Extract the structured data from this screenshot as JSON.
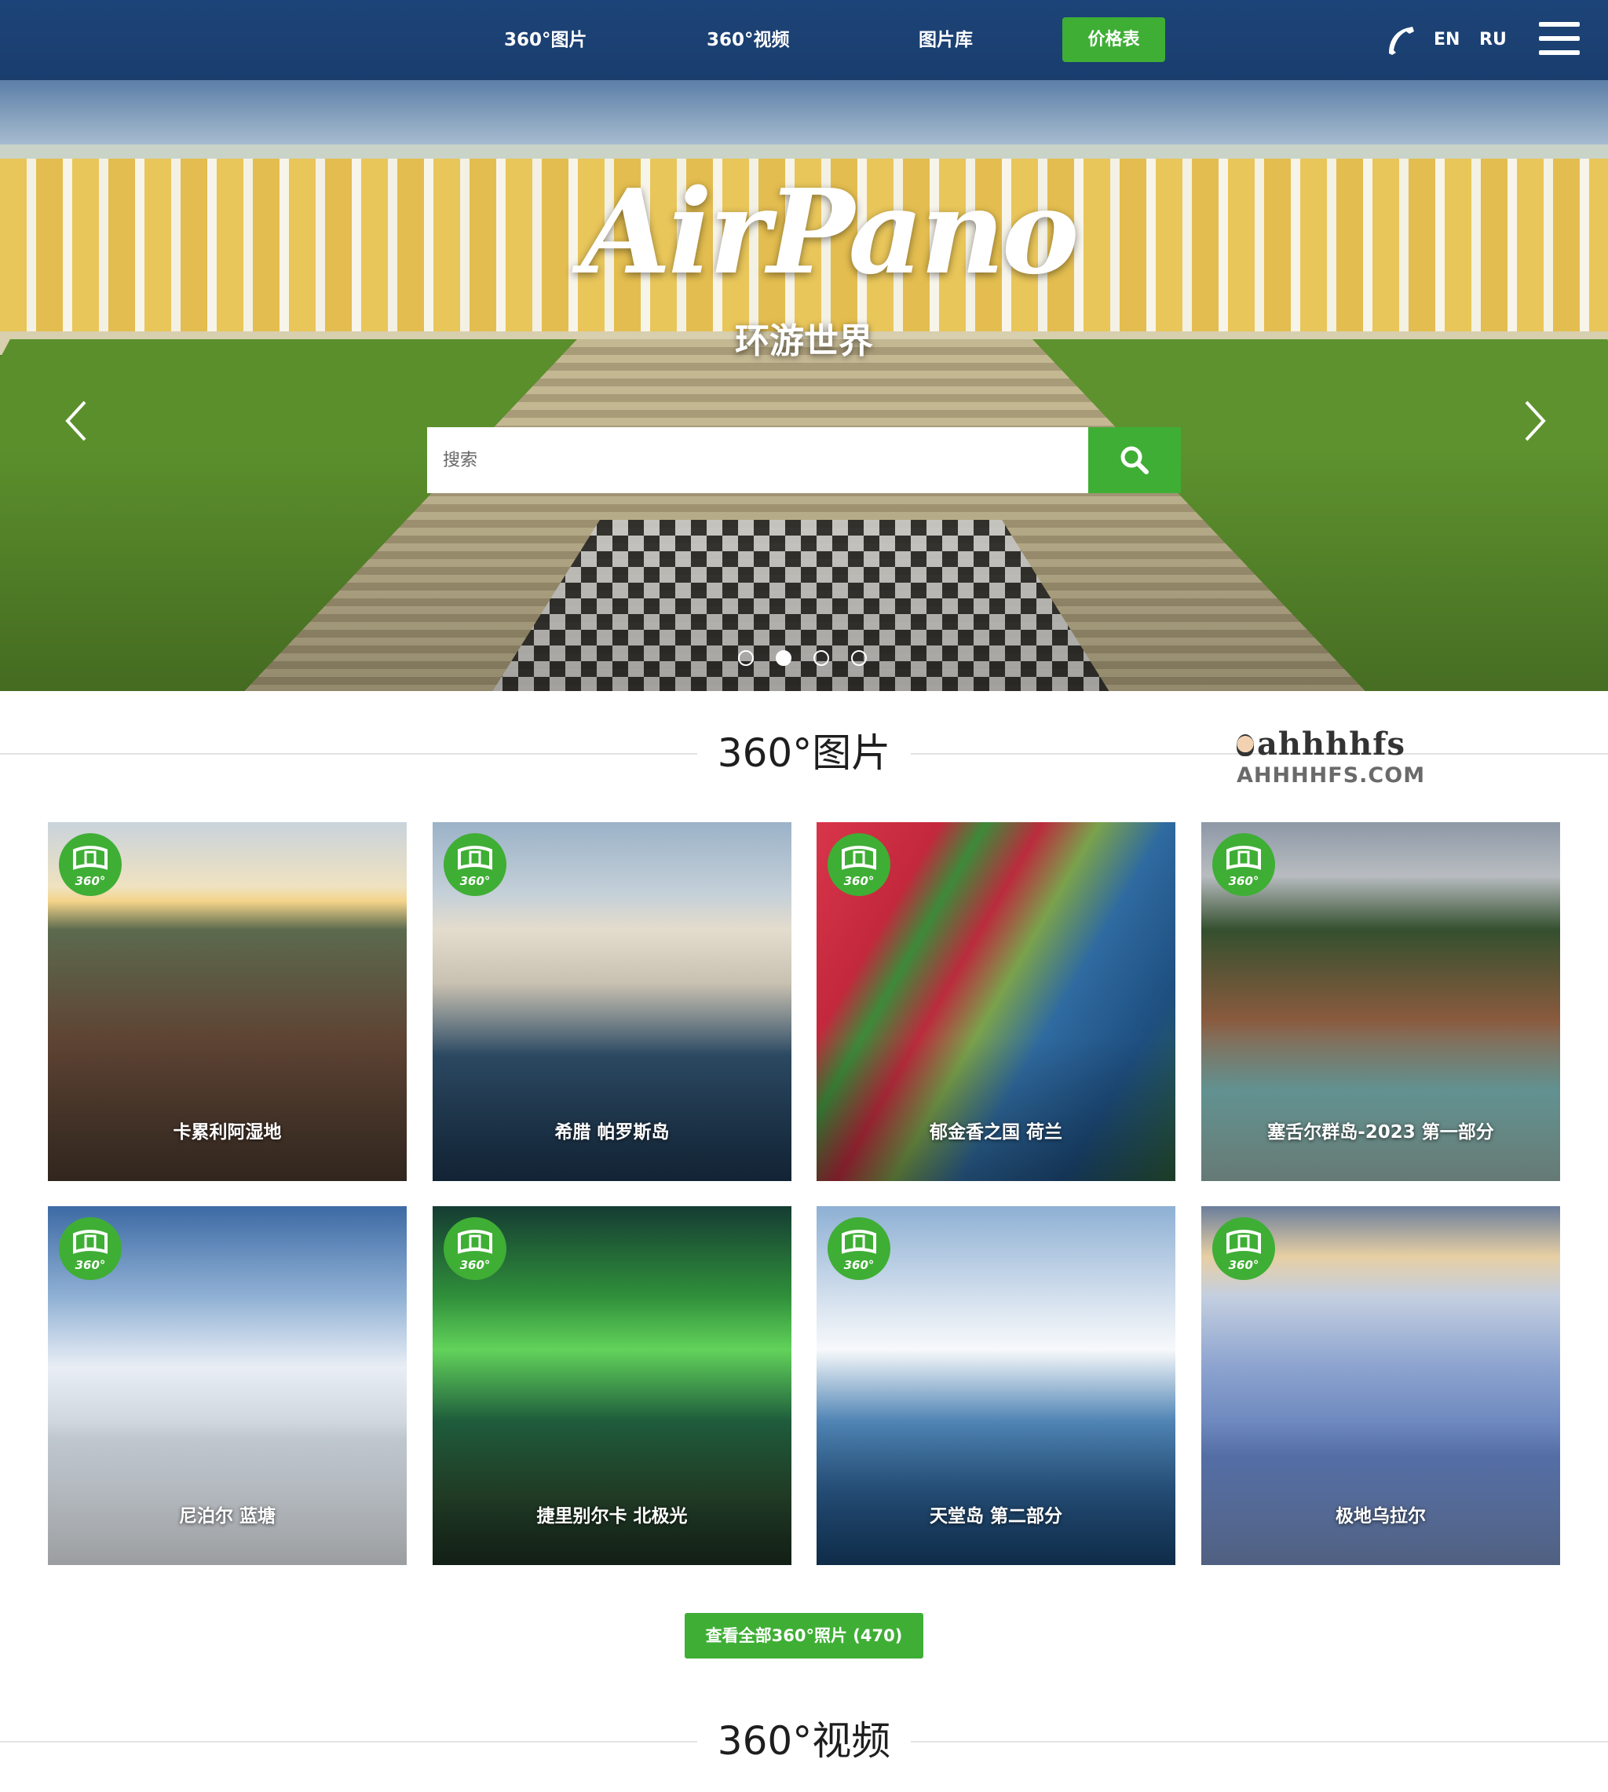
{
  "header": {
    "nav": [
      {
        "label": "360°图片"
      },
      {
        "label": "360°视频"
      },
      {
        "label": "图片库"
      }
    ],
    "price_label": "价格表",
    "languages": [
      "EN",
      "RU"
    ],
    "icons": {
      "phone": "phone-icon",
      "menu": "hamburger-menu-icon"
    },
    "accent_color": "#3fae35",
    "bar_color": "#1d4478"
  },
  "hero": {
    "logo": "AirPano",
    "tagline": "环游世界",
    "search": {
      "placeholder": "搜索",
      "value": ""
    },
    "slider": {
      "slide_count": 4,
      "active_slide": 2
    }
  },
  "photos_section": {
    "title": "360°图片",
    "watermark": {
      "brand": "ahhhhfs",
      "domain": "AHHHHFS.COM"
    },
    "cards": [
      {
        "title": "卡累利阿湿地"
      },
      {
        "title": "希腊 帕罗斯岛"
      },
      {
        "title": "郁金香之国 荷兰"
      },
      {
        "title": "塞舌尔群岛-2023 第一部分"
      },
      {
        "title": "尼泊尔 蓝塘"
      },
      {
        "title": "捷里别尔卡 北极光"
      },
      {
        "title": "天堂岛 第二部分"
      },
      {
        "title": "极地乌拉尔"
      }
    ],
    "badge_text": "360°",
    "view_all_label": "查看全部360°照片 (470)"
  },
  "videos_section": {
    "title": "360°视频"
  }
}
